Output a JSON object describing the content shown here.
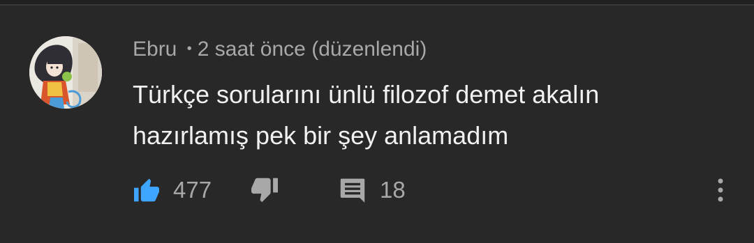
{
  "comment": {
    "author": "Ebru",
    "separator": "•",
    "timestamp": "2 saat önce",
    "edited_label": "(düzenlendi)",
    "text": "Türkçe sorularını ünlü filozof demet akalın hazırlamış pek bir şey anlamadım",
    "like_count": "477",
    "reply_count": "18"
  },
  "icons": {
    "like": "thumbs-up-icon",
    "dislike": "thumbs-down-icon",
    "reply": "comment-icon",
    "menu": "more-vertical-icon"
  },
  "colors": {
    "background": "#282828",
    "like_active": "#3ea6ff",
    "secondary_text": "#a8a8a8",
    "primary_text": "#f1f1f1"
  }
}
